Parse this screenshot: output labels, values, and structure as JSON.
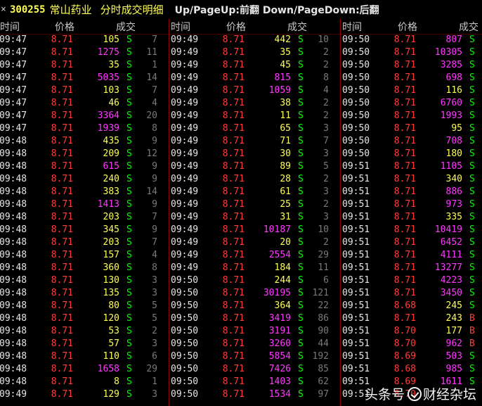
{
  "title": {
    "close_glyph": "×",
    "stock_code": "300255",
    "stock_name": "常山药业",
    "window_name": "分时成交明细",
    "hint": "Up/PageUp:前翻 Down/PageDown:后翻"
  },
  "headers": {
    "time": "时间",
    "price": "价格",
    "volume": "成交"
  },
  "colors": {
    "time": "#e6e6e6",
    "price_up": "#ff3c3c",
    "big_volume": "#ff39ff",
    "small_volume": "#ffff54",
    "sell": "#00ff00",
    "buy": "#ff3c3c",
    "count": "#7a7a7a",
    "separator": "#8c0000"
  },
  "columns": [
    {
      "rows": [
        {
          "t": "09:47",
          "p": "8.71",
          "v": "105",
          "c": "y",
          "s": "S",
          "n": "7"
        },
        {
          "t": "09:47",
          "p": "8.71",
          "v": "1275",
          "c": "m",
          "s": "S",
          "n": "11"
        },
        {
          "t": "09:47",
          "p": "8.71",
          "v": "35",
          "c": "y",
          "s": "S",
          "n": "1"
        },
        {
          "t": "09:47",
          "p": "8.71",
          "v": "5035",
          "c": "m",
          "s": "S",
          "n": "14"
        },
        {
          "t": "09:47",
          "p": "8.71",
          "v": "103",
          "c": "y",
          "s": "S",
          "n": "7"
        },
        {
          "t": "09:47",
          "p": "8.71",
          "v": "46",
          "c": "y",
          "s": "S",
          "n": "4"
        },
        {
          "t": "09:47",
          "p": "8.71",
          "v": "3364",
          "c": "m",
          "s": "S",
          "n": "20"
        },
        {
          "t": "09:47",
          "p": "8.71",
          "v": "1939",
          "c": "m",
          "s": "S",
          "n": "8"
        },
        {
          "t": "09:48",
          "p": "8.71",
          "v": "435",
          "c": "y",
          "s": "S",
          "n": "9"
        },
        {
          "t": "09:48",
          "p": "8.71",
          "v": "209",
          "c": "y",
          "s": "S",
          "n": "12"
        },
        {
          "t": "09:48",
          "p": "8.71",
          "v": "615",
          "c": "m",
          "s": "S",
          "n": "9"
        },
        {
          "t": "09:48",
          "p": "8.71",
          "v": "240",
          "c": "y",
          "s": "S",
          "n": "9"
        },
        {
          "t": "09:48",
          "p": "8.71",
          "v": "383",
          "c": "y",
          "s": "S",
          "n": "14"
        },
        {
          "t": "09:48",
          "p": "8.71",
          "v": "1413",
          "c": "m",
          "s": "S",
          "n": "9"
        },
        {
          "t": "09:48",
          "p": "8.71",
          "v": "203",
          "c": "y",
          "s": "S",
          "n": "7"
        },
        {
          "t": "09:48",
          "p": "8.71",
          "v": "345",
          "c": "y",
          "s": "S",
          "n": "9"
        },
        {
          "t": "09:48",
          "p": "8.71",
          "v": "203",
          "c": "y",
          "s": "S",
          "n": "7"
        },
        {
          "t": "09:48",
          "p": "8.71",
          "v": "157",
          "c": "y",
          "s": "S",
          "n": "4"
        },
        {
          "t": "09:48",
          "p": "8.71",
          "v": "360",
          "c": "y",
          "s": "S",
          "n": "8"
        },
        {
          "t": "09:48",
          "p": "8.71",
          "v": "130",
          "c": "y",
          "s": "S",
          "n": "3"
        },
        {
          "t": "09:48",
          "p": "8.71",
          "v": "135",
          "c": "y",
          "s": "S",
          "n": "3"
        },
        {
          "t": "09:48",
          "p": "8.71",
          "v": "80",
          "c": "y",
          "s": "S",
          "n": "5"
        },
        {
          "t": "09:48",
          "p": "8.71",
          "v": "120",
          "c": "y",
          "s": "S",
          "n": "5"
        },
        {
          "t": "09:48",
          "p": "8.71",
          "v": "53",
          "c": "y",
          "s": "S",
          "n": "2"
        },
        {
          "t": "09:48",
          "p": "8.71",
          "v": "57",
          "c": "y",
          "s": "S",
          "n": "3"
        },
        {
          "t": "09:48",
          "p": "8.71",
          "v": "110",
          "c": "y",
          "s": "S",
          "n": "6"
        },
        {
          "t": "09:48",
          "p": "8.71",
          "v": "1658",
          "c": "m",
          "s": "S",
          "n": "29"
        },
        {
          "t": "09:48",
          "p": "8.71",
          "v": "8",
          "c": "y",
          "s": "S",
          "n": "1"
        },
        {
          "t": "09:49",
          "p": "8.71",
          "v": "129",
          "c": "y",
          "s": "S",
          "n": "3"
        }
      ]
    },
    {
      "rows": [
        {
          "t": "09:49",
          "p": "8.71",
          "v": "442",
          "c": "y",
          "s": "S",
          "n": "10"
        },
        {
          "t": "09:49",
          "p": "8.71",
          "v": "35",
          "c": "y",
          "s": "S",
          "n": "2"
        },
        {
          "t": "09:49",
          "p": "8.71",
          "v": "45",
          "c": "y",
          "s": "S",
          "n": "2"
        },
        {
          "t": "09:49",
          "p": "8.71",
          "v": "815",
          "c": "m",
          "s": "S",
          "n": "8"
        },
        {
          "t": "09:49",
          "p": "8.71",
          "v": "1059",
          "c": "m",
          "s": "S",
          "n": "4"
        },
        {
          "t": "09:49",
          "p": "8.71",
          "v": "38",
          "c": "y",
          "s": "S",
          "n": "2"
        },
        {
          "t": "09:49",
          "p": "8.71",
          "v": "11",
          "c": "y",
          "s": "S",
          "n": "2"
        },
        {
          "t": "09:49",
          "p": "8.71",
          "v": "65",
          "c": "y",
          "s": "S",
          "n": "3"
        },
        {
          "t": "09:49",
          "p": "8.71",
          "v": "71",
          "c": "y",
          "s": "S",
          "n": "7"
        },
        {
          "t": "09:49",
          "p": "8.71",
          "v": "30",
          "c": "y",
          "s": "S",
          "n": "3"
        },
        {
          "t": "09:49",
          "p": "8.71",
          "v": "89",
          "c": "y",
          "s": "S",
          "n": "5"
        },
        {
          "t": "09:49",
          "p": "8.71",
          "v": "28",
          "c": "y",
          "s": "S",
          "n": "2"
        },
        {
          "t": "09:49",
          "p": "8.71",
          "v": "61",
          "c": "y",
          "s": "S",
          "n": "3"
        },
        {
          "t": "09:49",
          "p": "8.71",
          "v": "25",
          "c": "y",
          "s": "S",
          "n": "2"
        },
        {
          "t": "09:49",
          "p": "8.71",
          "v": "31",
          "c": "y",
          "s": "S",
          "n": "3"
        },
        {
          "t": "09:49",
          "p": "8.71",
          "v": "10187",
          "c": "m",
          "s": "S",
          "n": "10"
        },
        {
          "t": "09:49",
          "p": "8.71",
          "v": "20",
          "c": "y",
          "s": "S",
          "n": "2"
        },
        {
          "t": "09:49",
          "p": "8.71",
          "v": "2554",
          "c": "m",
          "s": "S",
          "n": "29"
        },
        {
          "t": "09:49",
          "p": "8.71",
          "v": "184",
          "c": "y",
          "s": "S",
          "n": "11"
        },
        {
          "t": "09:50",
          "p": "8.71",
          "v": "244",
          "c": "y",
          "s": "S",
          "n": "6"
        },
        {
          "t": "09:50",
          "p": "8.71",
          "v": "30195",
          "c": "m",
          "s": "S",
          "n": "121"
        },
        {
          "t": "09:50",
          "p": "8.71",
          "v": "364",
          "c": "y",
          "s": "S",
          "n": "22"
        },
        {
          "t": "09:50",
          "p": "8.71",
          "v": "3419",
          "c": "m",
          "s": "S",
          "n": "86"
        },
        {
          "t": "09:50",
          "p": "8.71",
          "v": "3191",
          "c": "m",
          "s": "S",
          "n": "90"
        },
        {
          "t": "09:50",
          "p": "8.71",
          "v": "3260",
          "c": "m",
          "s": "S",
          "n": "44"
        },
        {
          "t": "09:50",
          "p": "8.71",
          "v": "5854",
          "c": "m",
          "s": "S",
          "n": "192"
        },
        {
          "t": "09:50",
          "p": "8.71",
          "v": "7426",
          "c": "m",
          "s": "S",
          "n": "85"
        },
        {
          "t": "09:50",
          "p": "8.71",
          "v": "1403",
          "c": "m",
          "s": "S",
          "n": "62"
        },
        {
          "t": "09:50",
          "p": "8.71",
          "v": "1534",
          "c": "m",
          "s": "S",
          "n": "97"
        }
      ]
    },
    {
      "rows": [
        {
          "t": "09:50",
          "p": "8.71",
          "v": "807",
          "c": "m",
          "s": "S",
          "n": ""
        },
        {
          "t": "09:50",
          "p": "8.71",
          "v": "10305",
          "c": "m",
          "s": "S",
          "n": ""
        },
        {
          "t": "09:50",
          "p": "8.71",
          "v": "3285",
          "c": "m",
          "s": "S",
          "n": ""
        },
        {
          "t": "09:50",
          "p": "8.71",
          "v": "698",
          "c": "m",
          "s": "S",
          "n": ""
        },
        {
          "t": "09:50",
          "p": "8.71",
          "v": "116",
          "c": "y",
          "s": "S",
          "n": ""
        },
        {
          "t": "09:50",
          "p": "8.71",
          "v": "6760",
          "c": "m",
          "s": "S",
          "n": ""
        },
        {
          "t": "09:50",
          "p": "8.71",
          "v": "1993",
          "c": "m",
          "s": "S",
          "n": ""
        },
        {
          "t": "09:50",
          "p": "8.71",
          "v": "95",
          "c": "y",
          "s": "S",
          "n": ""
        },
        {
          "t": "09:50",
          "p": "8.71",
          "v": "708",
          "c": "m",
          "s": "S",
          "n": ""
        },
        {
          "t": "09:50",
          "p": "8.71",
          "v": "180",
          "c": "y",
          "s": "S",
          "n": ""
        },
        {
          "t": "09:51",
          "p": "8.71",
          "v": "1105",
          "c": "m",
          "s": "S",
          "n": ""
        },
        {
          "t": "09:51",
          "p": "8.71",
          "v": "340",
          "c": "y",
          "s": "S",
          "n": ""
        },
        {
          "t": "09:51",
          "p": "8.71",
          "v": "886",
          "c": "m",
          "s": "S",
          "n": ""
        },
        {
          "t": "09:51",
          "p": "8.71",
          "v": "973",
          "c": "m",
          "s": "S",
          "n": ""
        },
        {
          "t": "09:51",
          "p": "8.71",
          "v": "335",
          "c": "y",
          "s": "S",
          "n": ""
        },
        {
          "t": "09:51",
          "p": "8.71",
          "v": "10419",
          "c": "m",
          "s": "S",
          "n": ""
        },
        {
          "t": "09:51",
          "p": "8.71",
          "v": "6452",
          "c": "m",
          "s": "S",
          "n": ""
        },
        {
          "t": "09:51",
          "p": "8.71",
          "v": "4111",
          "c": "m",
          "s": "S",
          "n": ""
        },
        {
          "t": "09:51",
          "p": "8.71",
          "v": "13277",
          "c": "m",
          "s": "S",
          "n": ""
        },
        {
          "t": "09:51",
          "p": "8.71",
          "v": "4223",
          "c": "m",
          "s": "S",
          "n": ""
        },
        {
          "t": "09:51",
          "p": "8.71",
          "v": "3450",
          "c": "m",
          "s": "S",
          "n": ""
        },
        {
          "t": "09:51",
          "p": "8.68",
          "v": "245",
          "c": "y",
          "s": "S",
          "n": ""
        },
        {
          "t": "09:51",
          "p": "8.71",
          "v": "243",
          "c": "y",
          "s": "B",
          "n": ""
        },
        {
          "t": "09:51",
          "p": "8.70",
          "v": "177",
          "c": "y",
          "s": "B",
          "n": ""
        },
        {
          "t": "09:51",
          "p": "8.70",
          "v": "962",
          "c": "m",
          "s": "B",
          "n": ""
        },
        {
          "t": "09:51",
          "p": "8.69",
          "v": "503",
          "c": "m",
          "s": "S",
          "n": ""
        },
        {
          "t": "09:51",
          "p": "8.68",
          "v": "985",
          "c": "m",
          "s": "S",
          "n": ""
        },
        {
          "t": "09:51",
          "p": "8.69",
          "v": "1611",
          "c": "m",
          "s": "S",
          "n": ""
        },
        {
          "t": "09:51",
          "p": "8.70",
          "v": "",
          "c": "y",
          "s": "",
          "n": ""
        }
      ]
    }
  ],
  "watermark": {
    "text_left": "头条号",
    "text_right": "财经杂坛",
    "icon": "check-circle-icon"
  }
}
